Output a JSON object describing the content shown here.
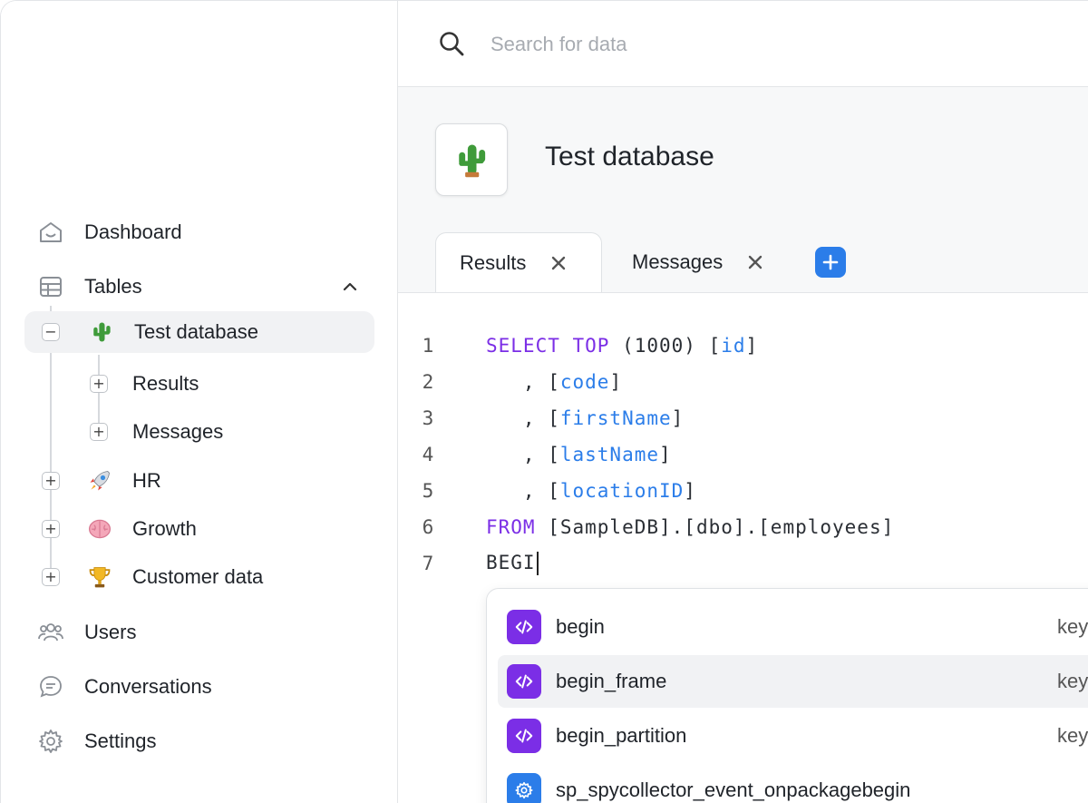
{
  "search": {
    "placeholder": "Search for data"
  },
  "sidebar": {
    "nav": {
      "dashboard": "Dashboard",
      "tables": "Tables",
      "users": "Users",
      "conversations": "Conversations",
      "settings": "Settings"
    },
    "tree": [
      {
        "label": "Test database",
        "icon": "cactus-icon",
        "toggle": "−",
        "selected": true
      },
      {
        "label": "Results",
        "toggle": "+"
      },
      {
        "label": "Messages",
        "toggle": "+"
      },
      {
        "label": "HR",
        "icon": "rocket-icon",
        "toggle": "+"
      },
      {
        "label": "Growth",
        "icon": "brain-icon",
        "toggle": "+"
      },
      {
        "label": "Customer data",
        "icon": "trophy-icon",
        "toggle": "+"
      }
    ]
  },
  "header": {
    "title": "Test database",
    "icon": "cactus-icon",
    "tabs": [
      {
        "label": "Results",
        "active": true
      },
      {
        "label": "Messages",
        "active": false
      }
    ]
  },
  "editor": {
    "line_numbers": [
      "1",
      "2",
      "3",
      "4",
      "5",
      "6",
      "7"
    ],
    "line1": {
      "kw1": "SELECT",
      "kw2": "TOP",
      "plain": " (1000) [",
      "id": "id",
      "end": "]"
    },
    "line2": {
      "pre": "   , [",
      "id": "code",
      "end": "]"
    },
    "line3": {
      "pre": "   , [",
      "id": "firstName",
      "end": "]"
    },
    "line4": {
      "pre": "   , [",
      "id": "lastName",
      "end": "]"
    },
    "line5": {
      "pre": "   , [",
      "id": "locationID",
      "end": "]"
    },
    "line6": {
      "kw": "FROM",
      "rest": " [SampleDB].[dbo].[employees]"
    },
    "line7": {
      "text": "BEGI"
    }
  },
  "autocomplete": {
    "items": [
      {
        "label": "begin",
        "kind": "key",
        "icon": "code-icon"
      },
      {
        "label": "begin_frame",
        "kind": "key",
        "icon": "code-icon",
        "highlighted": true
      },
      {
        "label": "begin_partition",
        "kind": "key",
        "icon": "code-icon"
      },
      {
        "label": "sp_spycollector_event_onpackagebegin",
        "kind": "",
        "icon": "gear-icon"
      }
    ]
  },
  "colors": {
    "keyword": "#7b2ee6",
    "identifier": "#2b7de9",
    "accent": "#2b7de9"
  }
}
